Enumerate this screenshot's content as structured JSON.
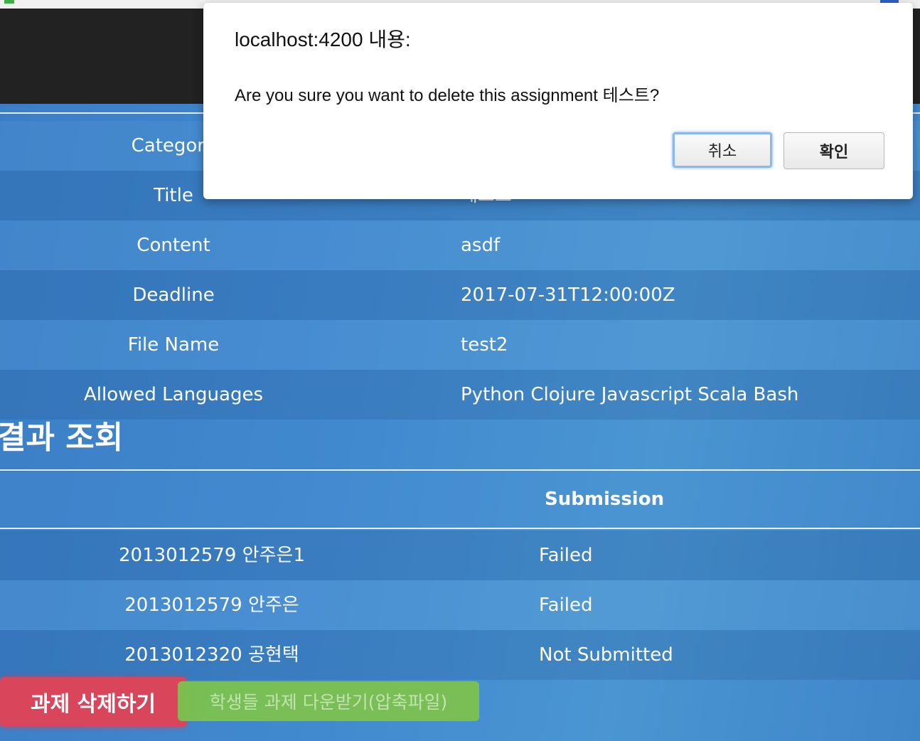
{
  "dialog": {
    "title": "localhost:4200 내용:",
    "message": "Are you sure you want to delete this assignment 테스트?",
    "cancel_label": "취소",
    "ok_label": "확인"
  },
  "assignment_info": {
    "rows": [
      {
        "label": "Category",
        "value": ""
      },
      {
        "label": "Title",
        "value": "테스트"
      },
      {
        "label": "Content",
        "value": "asdf"
      },
      {
        "label": "Deadline",
        "value": "2017-07-31T12:00:00Z"
      },
      {
        "label": "File Name",
        "value": "test2"
      },
      {
        "label": "Allowed Languages",
        "value": "Python Clojure Javascript Scala Bash"
      }
    ]
  },
  "results": {
    "title": "결과 조회",
    "submission_header": "Submission",
    "rows": [
      {
        "student": "2013012579 안주은1",
        "submission": "Failed"
      },
      {
        "student": "2013012579 안주은",
        "submission": "Failed"
      },
      {
        "student": "2013012320 공현택",
        "submission": "Not Submitted"
      }
    ]
  },
  "actions": {
    "delete_label": "과제 삭제하기",
    "download_label": "학생들 과제 다운받기(압축파일)"
  },
  "colors": {
    "delete_button": "#d9465c",
    "download_button": "#7cc24f",
    "navbar": "#222222",
    "page_background": "#4189cf"
  }
}
